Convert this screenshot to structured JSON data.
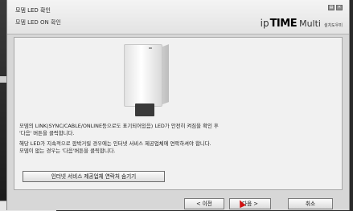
{
  "header": {
    "step_title": "모뎀 LED 확인",
    "step_subtitle": "모뎀 LED ON 확인",
    "brand": {
      "ip": "ip",
      "time": "TIME",
      "multi": "Multi",
      "kr": "설치도우미"
    },
    "window_buttons": [
      "▤",
      "✕"
    ]
  },
  "content": {
    "instructions": [
      "모뎀의 LINK(SYNC/CABLE/ONLINE등으로도 표기되어있음) LED가 안전히 켜짐을 확인 후",
      "'다음' 버튼을 클릭합니다."
    ],
    "notes": [
      "해당 LED가 지속적으로 깜박거릴 경우에는 인터넷 서비스 제공업체에 연락하셔야 합니다.",
      "모뎀이 없는 경우는 '다음'버튼을 클릭합니다."
    ],
    "isp_contact_button": "인터넷 서비스 제공업체 연락처 숨기기"
  },
  "footer": {
    "prev_label": "< 이전",
    "next_label": "다음 >",
    "cancel_label": "취소"
  },
  "colors": {
    "dialog_bg": "#d7d7d7",
    "content_bg": "#f1f1f1",
    "cursor": "#d01010"
  }
}
